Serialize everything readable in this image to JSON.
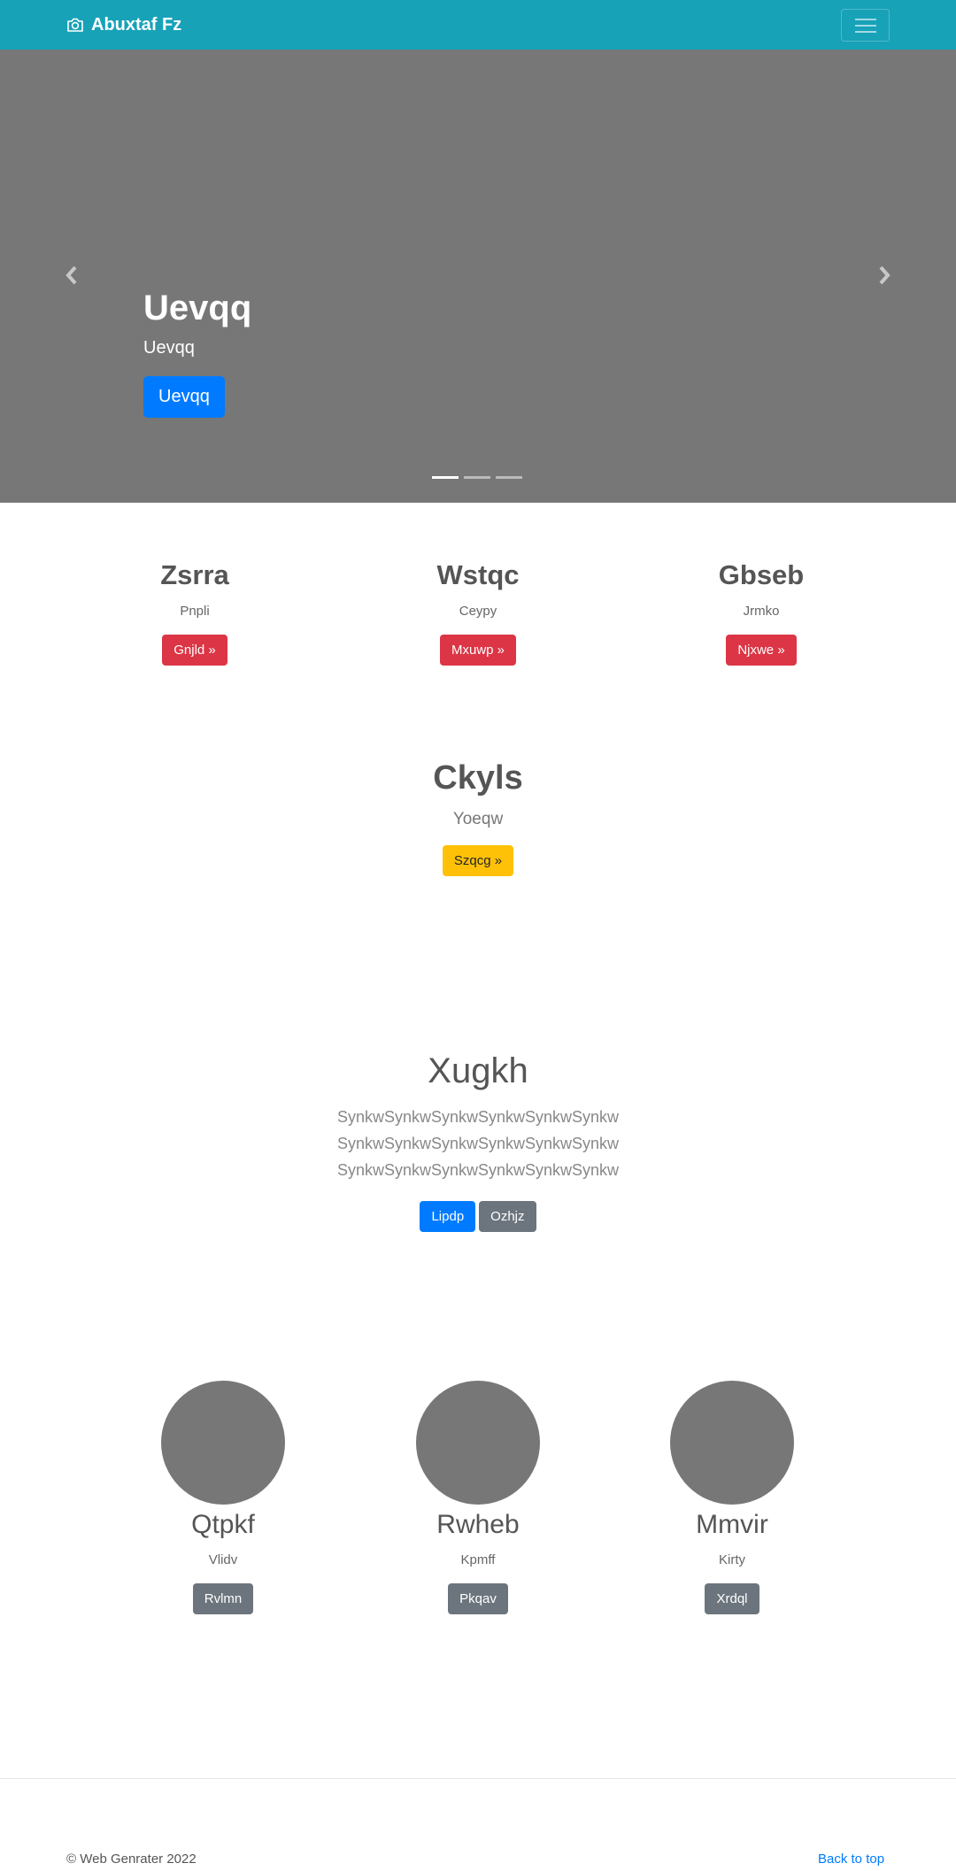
{
  "navbar": {
    "brand": "Abuxtaf Fz",
    "brand_icon": "camera-icon",
    "toggle_icon": "hamburger-menu-icon",
    "bg_color": "#17a2b8"
  },
  "carousel": {
    "title": "Uevqq",
    "subtitle": "Uevqq",
    "button_label": "Uevqq",
    "slide_count": 3,
    "active_slide": 1,
    "prev_icon": "chevron-left-icon",
    "next_icon": "chevron-right-icon"
  },
  "columns": [
    {
      "title": "Zsrra",
      "text": "Pnpli",
      "button": "Gnjld »"
    },
    {
      "title": "Wstqc",
      "text": "Ceypy",
      "button": "Mxuwp »"
    },
    {
      "title": "Gbseb",
      "text": "Jrmko",
      "button": "Njxwe »"
    }
  ],
  "featured": {
    "title": "Ckyls",
    "text": "Yoeqw",
    "button": "Szqcg »"
  },
  "jumbotron": {
    "title": "Xugkh",
    "text": "SynkwSynkwSynkwSynkwSynkwSynkwSynkwSynkwSynkwSynkwSynkwSynkwSynkwSynkwSynkwSynkwSynkwSynkw",
    "primary_button": "Lipdp",
    "secondary_button": "Ozhjz"
  },
  "people": [
    {
      "name": "Qtpkf",
      "text": "Vlidv",
      "button": "Rvlmn"
    },
    {
      "name": "Rwheb",
      "text": "Kpmff",
      "button": "Pkqav"
    },
    {
      "name": "Mmvir",
      "text": "Kirty",
      "button": "Xrdql"
    }
  ],
  "footer": {
    "copyright": "© Web Genrater 2022",
    "back_to_top": "Back to top"
  },
  "colors": {
    "primary": "#007bff",
    "danger": "#dc3545",
    "warning": "#ffc107",
    "secondary": "#6c757d",
    "placeholder": "#777777"
  }
}
